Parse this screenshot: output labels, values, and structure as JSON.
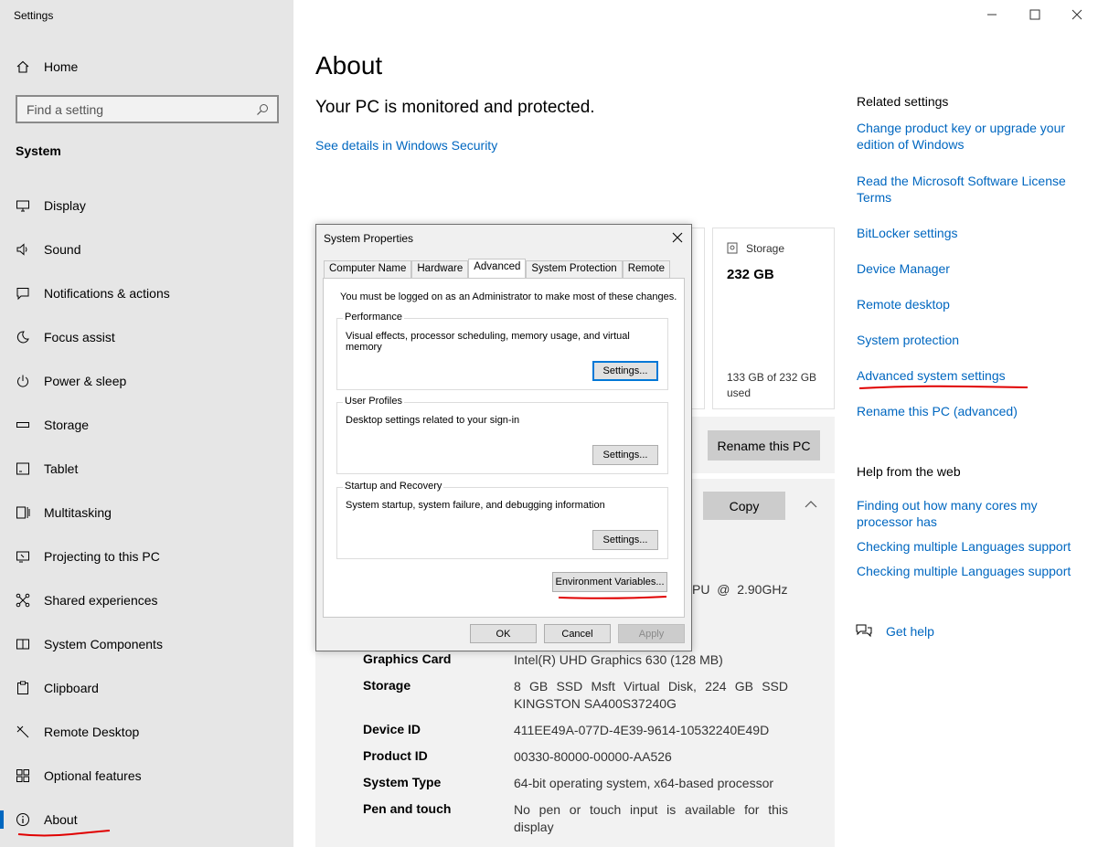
{
  "app": {
    "title": "Settings"
  },
  "sidebar": {
    "home_label": "Home",
    "search_placeholder": "Find a setting",
    "section": "System",
    "items": [
      {
        "label": "Display",
        "icon": "monitor-icon"
      },
      {
        "label": "Sound",
        "icon": "speaker-icon"
      },
      {
        "label": "Notifications & actions",
        "icon": "notification-icon"
      },
      {
        "label": "Focus assist",
        "icon": "moon-icon"
      },
      {
        "label": "Power & sleep",
        "icon": "power-icon"
      },
      {
        "label": "Storage",
        "icon": "storage-icon"
      },
      {
        "label": "Tablet",
        "icon": "tablet-icon"
      },
      {
        "label": "Multitasking",
        "icon": "multitasking-icon"
      },
      {
        "label": "Projecting to this PC",
        "icon": "projector-icon"
      },
      {
        "label": "Shared experiences",
        "icon": "share-icon"
      },
      {
        "label": "System Components",
        "icon": "components-icon"
      },
      {
        "label": "Clipboard",
        "icon": "clipboard-icon"
      },
      {
        "label": "Remote Desktop",
        "icon": "remote-icon"
      },
      {
        "label": "Optional features",
        "icon": "features-icon"
      },
      {
        "label": "About",
        "icon": "info-icon",
        "active": true
      }
    ]
  },
  "main": {
    "title": "About",
    "protected_text": "Your PC is monitored and protected.",
    "see_details_link": "See details in Windows Security",
    "storage_card": {
      "label": "Storage",
      "value": "232 GB",
      "used": "133 GB of 232 GB used"
    },
    "rename_button": "Rename this PC",
    "copy_button": "Copy",
    "processor_fragment": "PU  @  2.90GHz",
    "specs": [
      {
        "key": "Graphics Card",
        "value": "Intel(R) UHD Graphics 630 (128 MB)"
      },
      {
        "key": "Storage",
        "value": "8 GB SSD Msft Virtual Disk, 224 GB SSD KINGSTON SA400S37240G"
      },
      {
        "key": "Device ID",
        "value": "411EE49A-077D-4E39-9614-10532240E49D"
      },
      {
        "key": "Product ID",
        "value": "00330-80000-00000-AA526"
      },
      {
        "key": "System Type",
        "value": "64-bit operating system, x64-based processor"
      },
      {
        "key": "Pen and touch",
        "value": "No pen or touch input is available for this display"
      }
    ]
  },
  "related": {
    "heading": "Related settings",
    "links": [
      "Change product key or upgrade your edition of Windows",
      "Read the Microsoft Software License Terms",
      "BitLocker settings",
      "Device Manager",
      "Remote desktop",
      "System protection",
      "Advanced system settings",
      "Rename this PC (advanced)"
    ]
  },
  "help": {
    "heading": "Help from the web",
    "links": [
      "Finding out how many cores my processor has",
      "Checking multiple Languages support",
      "Checking multiple Languages support"
    ],
    "get_help": "Get help"
  },
  "dialog": {
    "title": "System Properties",
    "tabs": [
      "Computer Name",
      "Hardware",
      "Advanced",
      "System Protection",
      "Remote"
    ],
    "active_tab": "Advanced",
    "note": "You must be logged on as an Administrator to make most of these changes.",
    "groups": [
      {
        "label": "Performance",
        "desc": "Visual effects, processor scheduling, memory usage, and virtual memory",
        "button": "Settings..."
      },
      {
        "label": "User Profiles",
        "desc": "Desktop settings related to your sign-in",
        "button": "Settings..."
      },
      {
        "label": "Startup and Recovery",
        "desc": "System startup, system failure, and debugging information",
        "button": "Settings..."
      }
    ],
    "env_button": "Environment Variables...",
    "ok": "OK",
    "cancel": "Cancel",
    "apply": "Apply"
  },
  "colors": {
    "accent": "#0067c0",
    "annotation": "#e00000",
    "sidebar_bg": "#e6e6e6"
  }
}
